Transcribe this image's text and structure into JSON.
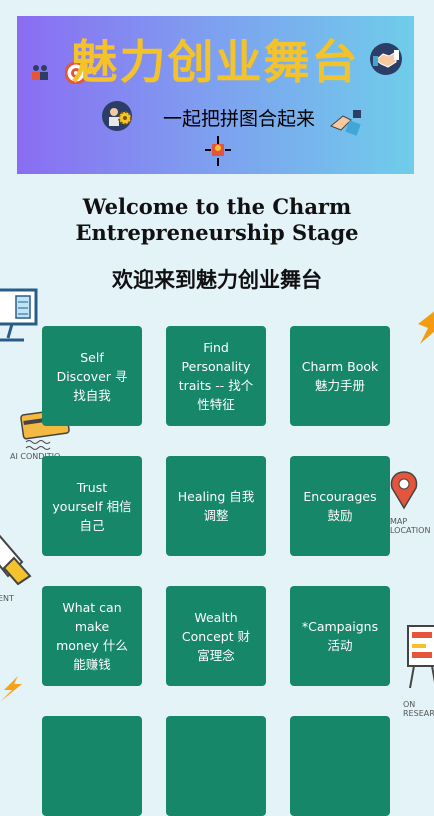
{
  "banner": {
    "title": "魅力创业舞台",
    "subtitle": "一起把拼图合起来"
  },
  "welcome": {
    "english": "Welcome to the Charm Entrepreneurship Stage",
    "chinese": "欢迎来到魅力创业舞台"
  },
  "tiles": [
    {
      "label": "Self Discover 寻找自我"
    },
    {
      "label": "Find Personality traits -- 找个性特征"
    },
    {
      "label": "Charm Book 魅力手册"
    },
    {
      "label": "Trust yourself 相信自己"
    },
    {
      "label": "Healing 自我调整"
    },
    {
      "label": "Encourages 鼓励"
    },
    {
      "label": "What can make money 什么能赚钱"
    },
    {
      "label": "Wealth Concept 财富理念"
    },
    {
      "label": "*Campaigns 活动"
    },
    {
      "label": ""
    },
    {
      "label": ""
    },
    {
      "label": ""
    }
  ],
  "background_text": {
    "card_caption": "AI CONDITIO",
    "laptop_caption": "ENT",
    "pin_caption": "MAP LOCATION",
    "board_caption": "ON RESEAR"
  },
  "colors": {
    "page_background": "#e3f3f8",
    "tile": "#17876a",
    "banner_title": "#f4c22b",
    "banner_gradient_start": "#8a6df2",
    "banner_gradient_end": "#6fcdea"
  },
  "icons": [
    "people-icon",
    "target-icon",
    "handshake-icon",
    "mentor-icon",
    "gear-icon",
    "puzzle-hand-icon",
    "puzzle-piece-icon"
  ]
}
